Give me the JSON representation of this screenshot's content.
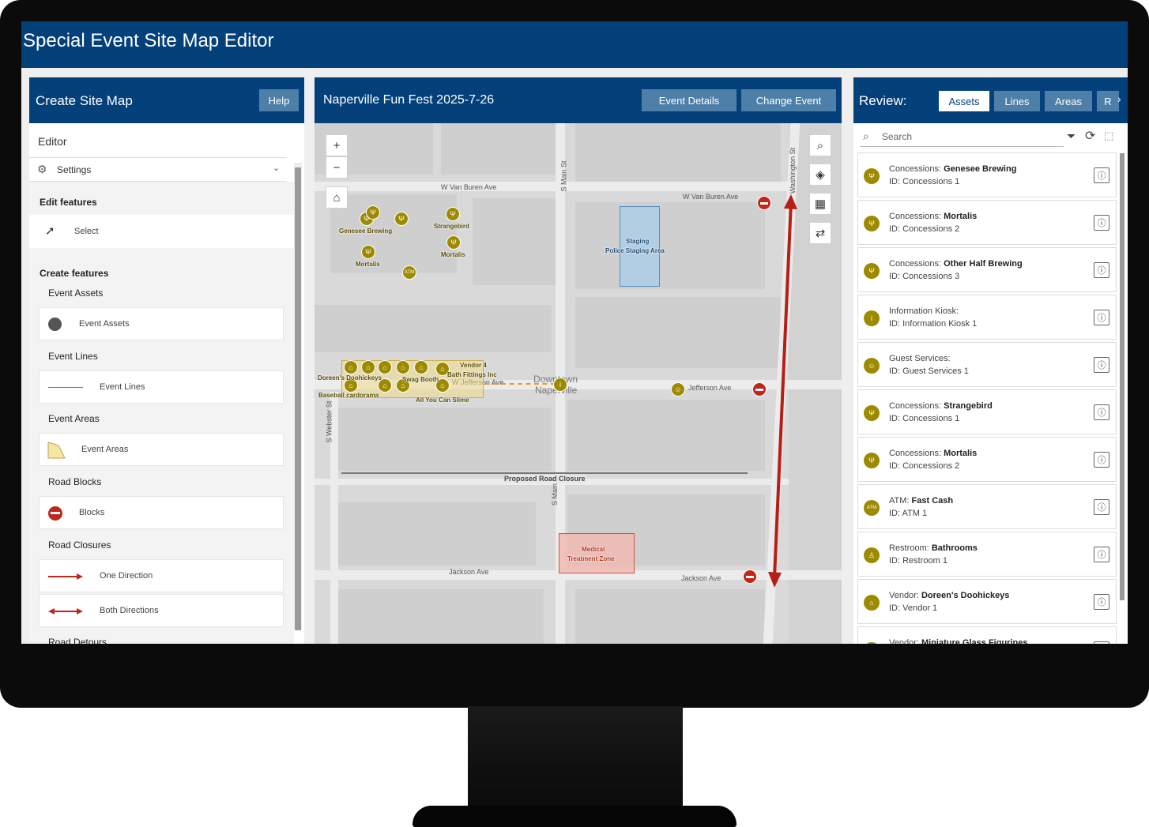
{
  "app": {
    "title": "Special Event Site Map Editor"
  },
  "left_panel": {
    "title": "Create Site Map",
    "help_label": "Help",
    "editor_label": "Editor",
    "settings_label": "Settings",
    "edit_features_heading": "Edit features",
    "select_label": "Select",
    "create_features_heading": "Create features",
    "groups": [
      {
        "heading": "Event Assets",
        "item": "Event Assets"
      },
      {
        "heading": "Event Lines",
        "item": "Event Lines"
      },
      {
        "heading": "Event Areas",
        "item": "Event Areas"
      },
      {
        "heading": "Road Blocks",
        "item": "Blocks"
      },
      {
        "heading": "Road Closures",
        "item": "One Direction",
        "item2": "Both Directions"
      },
      {
        "heading": "Road Detours"
      }
    ]
  },
  "map_panel": {
    "title": "Naperville Fun Fest 2025-7-26",
    "event_details_label": "Event Details",
    "change_event_label": "Change Event",
    "zoom_in": "+",
    "zoom_out": "−",
    "streets": {
      "van_buren_w": "W Van Buren Ave",
      "van_buren_e": "W Van Buren Ave",
      "main_st": "S Main St",
      "washington": "Washington St",
      "jefferson": "Jefferson Ave",
      "jefferson_w": "W Jefferson Ave",
      "jackson_w": "Jackson Ave",
      "jackson_e": "Jackson Ave",
      "webster": "S Webster St",
      "main_st_s": "S Main",
      "downtown": "Downtown",
      "naperville": "Naperville"
    },
    "labels": {
      "genesee": "Genesee Brewing",
      "strangebird": "Strangebird",
      "mortalis_w": "Mortalis",
      "mortalis_e": "Mortalis",
      "staging_1": "Staging",
      "staging_2": "Police Staging Area",
      "vendor4": "Vendor 4",
      "bath": "Bath Fittings Inc",
      "doreens": "Doreen's Doohickeys",
      "swag": "Swag Booth",
      "baseball": "Baseball cardorama",
      "slime": "All You Can Slime",
      "proposed_closure": "Proposed Road Closure",
      "medical_1": "Medical",
      "medical_2": "Treatment Zone",
      "atm": "ATM"
    }
  },
  "review_panel": {
    "title": "Review:",
    "tabs": [
      "Assets",
      "Lines",
      "Areas",
      "R"
    ],
    "search_placeholder": "Search",
    "items": [
      {
        "category": "Concessions:",
        "name": "Genesee Brewing",
        "id": "ID: Concessions 1",
        "icon": "fork-knife-icon"
      },
      {
        "category": "Concessions:",
        "name": "Mortalis",
        "id": "ID: Concessions 2",
        "icon": "fork-knife-icon"
      },
      {
        "category": "Concessions:",
        "name": "Other Half Brewing",
        "id": "ID: Concessions 3",
        "icon": "fork-knife-icon"
      },
      {
        "category": "Information Kiosk:",
        "name": "",
        "id": "ID: Information Kiosk 1",
        "icon": "info-icon"
      },
      {
        "category": "Guest Services:",
        "name": "",
        "id": "ID: Guest Services 1",
        "icon": "people-icon"
      },
      {
        "category": "Concessions:",
        "name": "Strangebird",
        "id": "ID: Concessions 1",
        "icon": "fork-knife-icon"
      },
      {
        "category": "Concessions:",
        "name": "Mortalis",
        "id": "ID: Concessions 2",
        "icon": "fork-knife-icon"
      },
      {
        "category": "ATM:",
        "name": "Fast Cash",
        "id": "ID: ATM 1",
        "icon": "atm-icon"
      },
      {
        "category": "Restroom:",
        "name": "Bathrooms",
        "id": "ID: Restroom 1",
        "icon": "restroom-icon"
      },
      {
        "category": "Vendor:",
        "name": "Doreen's Doohickeys",
        "id": "ID: Vendor 1",
        "icon": "vendor-icon"
      },
      {
        "category": "Vendor:",
        "name": "Miniature Glass Figurines",
        "id": "",
        "icon": "vendor-icon"
      }
    ]
  },
  "colors": {
    "header": "#04407a",
    "button": "#4e7fa8",
    "asset": "#9c8a00",
    "block": "#c0261b",
    "staging": "#a8cde8",
    "medical": "#f2b8b0"
  }
}
